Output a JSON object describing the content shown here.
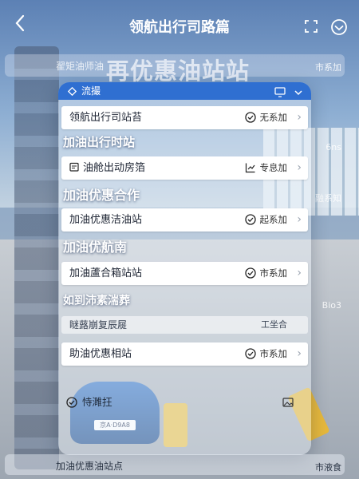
{
  "header": {
    "title": "领航出行司路篇"
  },
  "background": {
    "big_title": "再优惠油站站",
    "ghost_top_label": "翟矩油师油",
    "ghost_top_chip": "市系加",
    "ghost_chip_2": "6ns",
    "ghost_chip_3": "融系知",
    "ghost_chip_4": "Bio3",
    "ghost_bottom_label": "加油优惠油站点",
    "ghost_bottom_chip": "市液食",
    "plate": "京A·D9A8"
  },
  "panel": {
    "head_label": "流撮",
    "rows": [
      {
        "label": "领航出行司站苔",
        "chip": "无系加"
      },
      {
        "label": "油舱出动房箔",
        "chip": "专息加"
      },
      {
        "label": "加油优惠洁油站",
        "chip": "起系加"
      },
      {
        "label": "加油蘆合箱站站",
        "chip": "市系加"
      },
      {
        "label": "助油优惠相站",
        "chip": "市系加"
      }
    ],
    "sections": [
      {
        "label": "加油出行时站",
        "right": ""
      },
      {
        "label": "加油优惠合作",
        "right": ""
      },
      {
        "label": "加油优航南",
        "right": ""
      },
      {
        "label": "如到沛素湍葬",
        "right": "Bio3"
      }
    ],
    "sub_row": {
      "label": "瞇蕗崩复辰屣",
      "chip": "工坐合"
    },
    "footer_label": "恃濉抂"
  },
  "colors": {
    "accent": "#2f6fd1",
    "header_text": "#ffffff"
  }
}
